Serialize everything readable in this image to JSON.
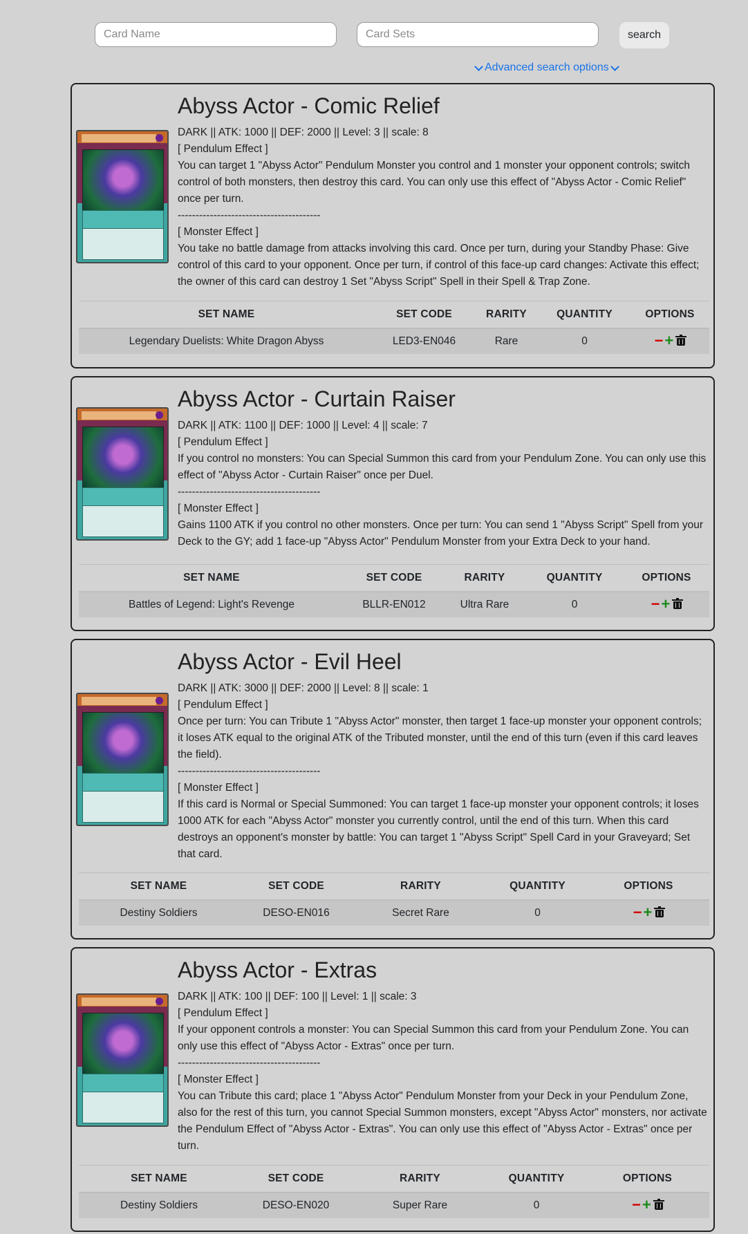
{
  "search": {
    "card_name_placeholder": "Card Name",
    "card_sets_placeholder": "Card Sets",
    "search_label": "search",
    "advanced_label": "Advanced search options"
  },
  "table_headers": {
    "set_name": "SET NAME",
    "set_code": "SET CODE",
    "rarity": "RARITY",
    "quantity": "QUANTITY",
    "options": "OPTIONS"
  },
  "colors": {
    "link": "#1a73e8",
    "remove": "#d40000",
    "add": "#1b8a1b",
    "background": "#d3d3d3"
  },
  "icons": [
    "chevron-down-icon",
    "minus-icon",
    "plus-icon",
    "trash-icon"
  ],
  "cards": [
    {
      "title": "Abyss Actor - Comic Relief",
      "stats": "DARK || ATK: 1000 || DEF: 2000 || Level: 3 || scale: 8",
      "pendulum_header": "[ Pendulum Effect ]",
      "pendulum_text": "You can target 1 \"Abyss Actor\" Pendulum Monster you control and 1 monster your opponent controls; switch control of both monsters, then destroy this card. You can only use this effect of \"Abyss Actor - Comic Relief\" once per turn.",
      "separator": "----------------------------------------",
      "monster_header": "[ Monster Effect ]",
      "monster_text": "You take no battle damage from attacks involving this card. Once per turn, during your Standby Phase: Give control of this card to your opponent. Once per turn, if control of this face-up card changes: Activate this effect; the owner of this card can destroy 1 Set \"Abyss Script\" Spell in their Spell & Trap Zone.",
      "set": {
        "name": "Legendary Duelists: White Dragon Abyss",
        "code": "LED3-EN046",
        "rarity": "Rare",
        "quantity": "0"
      }
    },
    {
      "title": "Abyss Actor - Curtain Raiser",
      "stats": "DARK || ATK: 1100 || DEF: 1000 || Level: 4 || scale: 7",
      "pendulum_header": "[ Pendulum Effect ]",
      "pendulum_text": "If you control no monsters: You can Special Summon this card from your Pendulum Zone. You can only use this effect of \"Abyss Actor - Curtain Raiser\" once per Duel.",
      "separator": "----------------------------------------",
      "monster_header": "[ Monster Effect ]",
      "monster_text": "Gains 1100 ATK if you control no other monsters. Once per turn: You can send 1 \"Abyss Script\" Spell from your Deck to the GY; add 1 face-up \"Abyss Actor\" Pendulum Monster from your Extra Deck to your hand.",
      "set": {
        "name": "Battles of Legend: Light's Revenge",
        "code": "BLLR-EN012",
        "rarity": "Ultra Rare",
        "quantity": "0"
      }
    },
    {
      "title": "Abyss Actor - Evil Heel",
      "stats": "DARK || ATK: 3000 || DEF: 2000 || Level: 8 || scale: 1",
      "pendulum_header": "[ Pendulum Effect ]",
      "pendulum_text": "Once per turn: You can Tribute 1 \"Abyss Actor\" monster, then target 1 face-up monster your opponent controls; it loses ATK equal to the original ATK of the Tributed monster, until the end of this turn (even if this card leaves the field).",
      "separator": "----------------------------------------",
      "monster_header": "[ Monster Effect ]",
      "monster_text": "If this card is Normal or Special Summoned: You can target 1 face-up monster your opponent controls; it loses 1000 ATK for each \"Abyss Actor\" monster you currently control, until the end of this turn. When this card destroys an opponent's monster by battle: You can target 1 \"Abyss Script\" Spell Card in your Graveyard; Set that card.",
      "set": {
        "name": "Destiny Soldiers",
        "code": "DESO-EN016",
        "rarity": "Secret Rare",
        "quantity": "0"
      }
    },
    {
      "title": "Abyss Actor - Extras",
      "stats": "DARK || ATK: 100 || DEF: 100 || Level: 1 || scale: 3",
      "pendulum_header": "[ Pendulum Effect ]",
      "pendulum_text": "If your opponent controls a monster: You can Special Summon this card from your Pendulum Zone. You can only use this effect of \"Abyss Actor - Extras\" once per turn.",
      "separator": "----------------------------------------",
      "monster_header": "[ Monster Effect ]",
      "monster_text": "You can Tribute this card; place 1 \"Abyss Actor\" Pendulum Monster from your Deck in your Pendulum Zone, also for the rest of this turn, you cannot Special Summon monsters, except \"Abyss Actor\" monsters, nor activate the Pendulum Effect of \"Abyss Actor - Extras\". You can only use this effect of \"Abyss Actor - Extras\" once per turn.",
      "set": {
        "name": "Destiny Soldiers",
        "code": "DESO-EN020",
        "rarity": "Super Rare",
        "quantity": "0"
      }
    }
  ]
}
